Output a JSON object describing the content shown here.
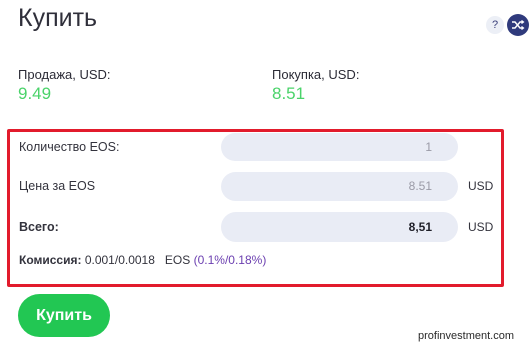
{
  "header": {
    "title": "Купить",
    "help_label": "?",
    "shuffle_icon": "shuffle-icon"
  },
  "prices": {
    "sell_label": "Продажа, USD:",
    "sell_value": "9.49",
    "buy_label": "Покупка, USD:",
    "buy_value": "8.51"
  },
  "form": {
    "quantity_label": "Количество EOS:",
    "quantity_value": "1",
    "price_label": "Цена за EOS",
    "price_value": "8.51",
    "price_unit": "USD",
    "total_label": "Всего:",
    "total_value": "8,51",
    "total_unit": "USD",
    "commission_label": "Комиссия:",
    "commission_value": "0.001/0.0018",
    "commission_currency": "EOS",
    "commission_percent": "(0.1%/0.18%)"
  },
  "actions": {
    "buy_label": "Купить"
  },
  "watermark": "profinvestment.com",
  "colors": {
    "accent_green": "#22c753",
    "price_green": "#4ad36a",
    "highlight_red": "#e21b2c",
    "commission_purple": "#6b3fb0"
  }
}
